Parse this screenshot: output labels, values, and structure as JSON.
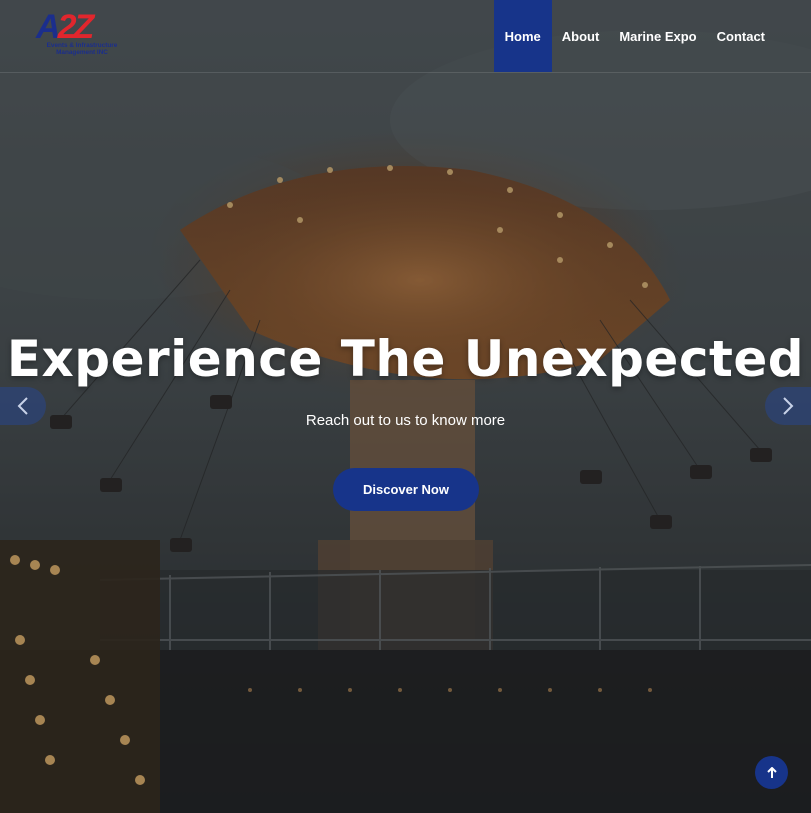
{
  "brand": {
    "logo_letters": [
      "A",
      "2",
      "Z"
    ],
    "logo_tagline_line1": "Events & Infrastructure",
    "logo_tagline_line2": "Management INC",
    "colors": {
      "primary": "#17348a",
      "accent": "#e1262d"
    }
  },
  "nav": {
    "items": [
      {
        "label": "Home",
        "active": true
      },
      {
        "label": "About",
        "active": false
      },
      {
        "label": "Marine Expo",
        "active": false
      },
      {
        "label": "Contact",
        "active": false
      }
    ]
  },
  "hero": {
    "title": "Experience The Unexpected",
    "subtitle": "Reach out to us to know more",
    "cta_label": "Discover Now",
    "prev_icon": "chevron-left-icon",
    "next_icon": "chevron-right-icon"
  },
  "scroll_top": {
    "icon": "arrow-up-icon"
  }
}
